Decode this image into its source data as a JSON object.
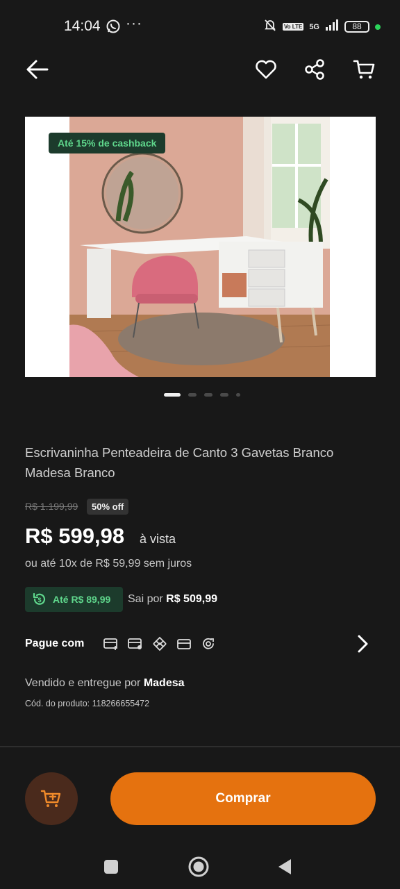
{
  "status_bar": {
    "time": "14:04",
    "network": "5G",
    "volte": "Vo LTE",
    "battery": "88"
  },
  "product": {
    "image_badge": "Até 15% de cashback",
    "title": "Escrivaninha Penteadeira de Canto 3 Gavetas Branco Madesa Branco",
    "old_price": "R$ 1.199,99",
    "discount": "50% off",
    "price": "R$ 599,98",
    "price_suffix": "à vista",
    "installments": "ou até 10x de R$ 59,99 sem juros",
    "pix_cashback": "Até R$ 89,99",
    "sai_por_label": "Sai por",
    "sai_por_value": "R$ 509,99",
    "pay_with_label": "Pague com",
    "sold_by_label": "Vendido e entregue por",
    "seller": "Madesa",
    "product_code": "Cód. do produto: 118266655472"
  },
  "gallery": {
    "total_images": 5,
    "active_index": 0
  },
  "actions": {
    "buy_label": "Comprar"
  },
  "icons": {
    "back": "arrow-left-icon",
    "favorite": "heart-icon",
    "share": "share-icon",
    "cart": "cart-icon",
    "payment_methods": [
      "credit-card-plus-icon",
      "card-stack-icon",
      "pix-icon",
      "debit-card-icon",
      "wallet-cashback-icon"
    ]
  },
  "colors": {
    "background": "#181818",
    "accent_orange": "#e5720f",
    "cashback_green": "#5fd78c",
    "cashback_bg": "#1c3b2c"
  }
}
